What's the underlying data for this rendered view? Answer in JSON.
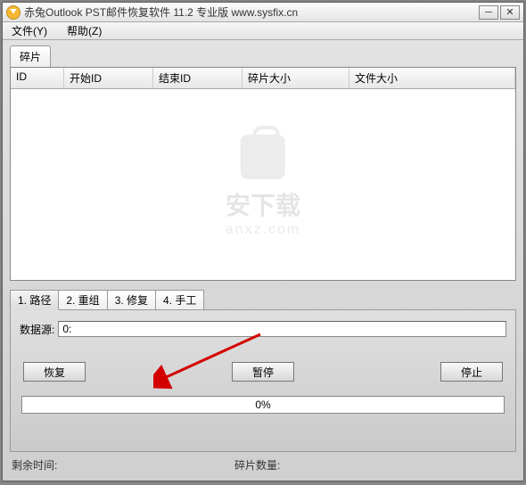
{
  "titlebar": {
    "title": "赤兔Outlook PST邮件恢复软件 11.2 专业版 www.sysfix.cn"
  },
  "menubar": {
    "file": "文件(Y)",
    "help": "帮助(Z)"
  },
  "top_tab": "碎片",
  "columns": {
    "id": "ID",
    "start_id": "开始ID",
    "end_id": "结束ID",
    "frag_size": "碎片大小",
    "file_size": "文件大小"
  },
  "watermark": {
    "line1": "安下载",
    "line2": "anxz.com"
  },
  "lower_tabs": {
    "t1": "1. 路径",
    "t2": "2. 重组",
    "t3": "3. 修复",
    "t4": "4. 手工"
  },
  "source": {
    "label": "数据源:",
    "value": "0:"
  },
  "buttons": {
    "recover": "恢复",
    "pause": "暂停",
    "stop": "停止"
  },
  "progress": "0%",
  "status": {
    "remaining": "剩余时间:",
    "frag_count": "碎片数量:"
  }
}
